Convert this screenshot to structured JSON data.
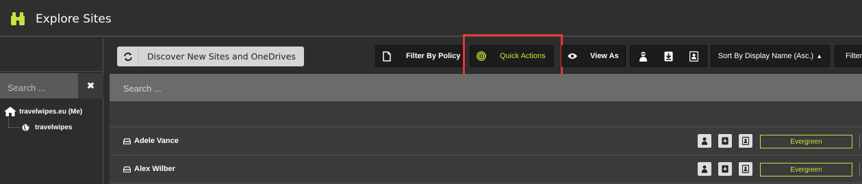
{
  "app": {
    "title": "Explore Sites",
    "icon": "binoculars-icon",
    "accent": "#c8e33a"
  },
  "sidebar": {
    "search_placeholder": "Search ...",
    "clear_icon": "close-icon",
    "tree": {
      "root": {
        "label": "travelwipes.eu (Me)",
        "icon": "home-icon"
      },
      "children": [
        {
          "label": "travelwipes",
          "icon": "globe-icon"
        }
      ]
    }
  },
  "toolbar": {
    "discover_label": "Discover New Sites and OneDrives",
    "filter_policy_label": "Filter By Policy",
    "quick_actions_label": "Quick Actions",
    "view_as_label": "View As",
    "sort_label": "Sort By Display Name (Asc.)",
    "filter_label": "Filter",
    "highlight_color": "#e53935"
  },
  "main": {
    "search_placeholder": "Search ..."
  },
  "rows": [
    {
      "name": "Adele Vance",
      "tag": "Evergreen"
    },
    {
      "name": "Alex Wilber",
      "tag": "Evergreen"
    }
  ]
}
